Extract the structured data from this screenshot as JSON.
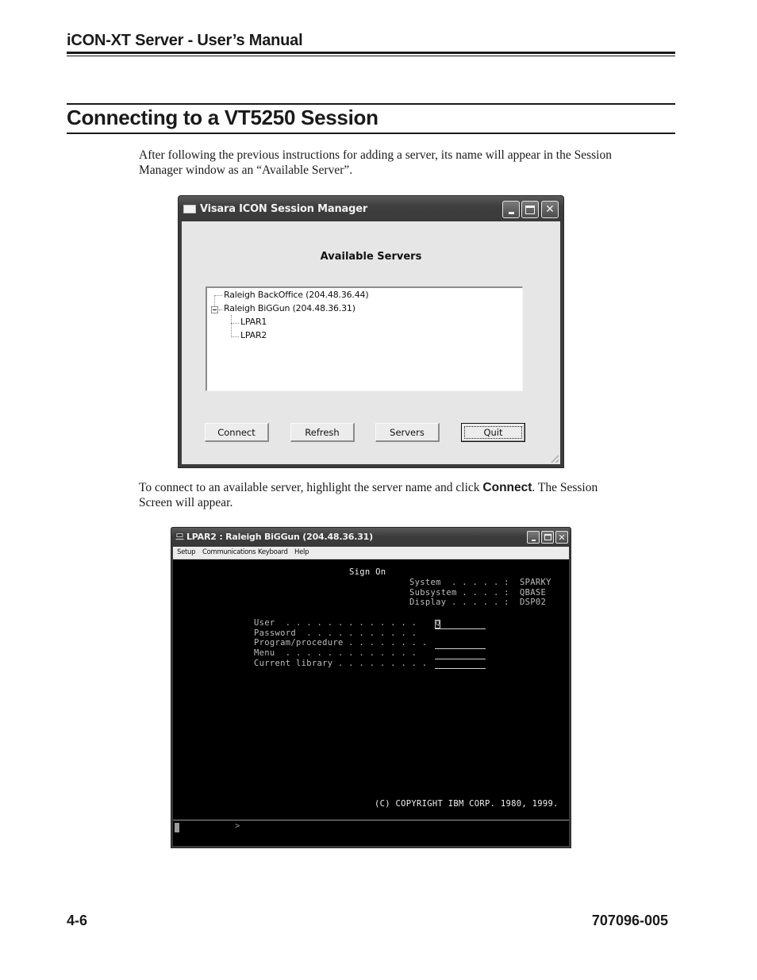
{
  "header": {
    "running_title": "iCON-XT Server - User’s Manual"
  },
  "section": {
    "title": "Connecting to a VT5250 Session"
  },
  "body": {
    "paragraph1": "After following the previous instructions for adding a server, its name will appear in the Session Manager window as an “Available Server”.",
    "paragraph2_before": "To connect to an available server, highlight the server name and click ",
    "paragraph2_bold": "Connect",
    "paragraph2_after": ". The Session Screen will appear."
  },
  "session_manager": {
    "window_title": "Visara ICON Session Manager",
    "heading": "Available Servers",
    "tree": [
      {
        "label": "Raleigh BackOffice (204.48.36.44)",
        "level": 0,
        "expanded": false
      },
      {
        "label": "Raleigh BiGGun (204.48.36.31)",
        "level": 0,
        "expanded": true
      },
      {
        "label": "LPAR1",
        "level": 1
      },
      {
        "label": "LPAR2",
        "level": 1
      }
    ],
    "buttons": {
      "connect": "Connect",
      "refresh": "Refresh",
      "servers": "Servers",
      "quit": "Quit"
    },
    "focused_button": "quit"
  },
  "terminal": {
    "window_title": "LPAR2 : Raleigh BiGGun (204.48.36.31)",
    "menu": [
      "Setup",
      "Communications",
      "Keyboard",
      "Help"
    ],
    "screen": {
      "title": "Sign On",
      "system_labels": "System  . . . . . :\nSubsystem . . . . :\nDisplay . . . . . :",
      "system_values": "SPARKY\nQBASE\nDSP02",
      "field_labels": "User  . . . . . . . . . . . . .\nPassword  . . . . . . . . . . .\nProgram/procedure . . . . . . . .\nMenu  . . . . . . . . . . . . .\nCurrent library . . . . . . . . .",
      "cursor_char": "Q",
      "copyright": "(C) COPYRIGHT IBM CORP. 1980, 1999.",
      "status_prompt": ">"
    }
  },
  "footer": {
    "page_number": "4-6",
    "doc_number": "707096-005"
  }
}
